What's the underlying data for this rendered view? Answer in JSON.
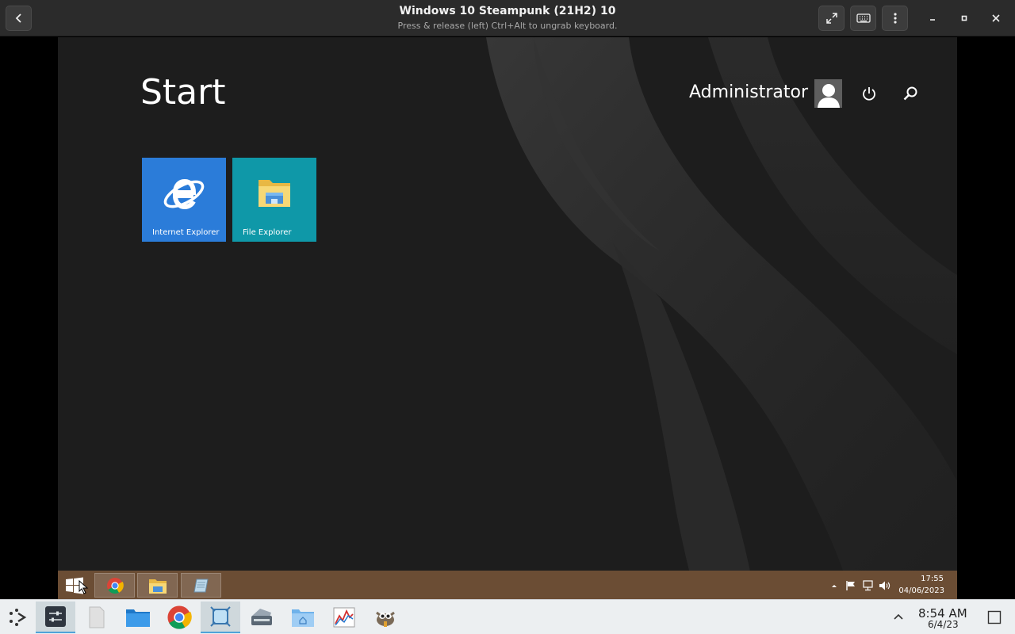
{
  "header": {
    "title": "Windows 10 Steampunk (21H2) 10",
    "subtitle": "Press & release (left) Ctrl+Alt to ungrab keyboard."
  },
  "start": {
    "title": "Start",
    "user_name": "Administrator",
    "tiles": [
      {
        "label": "Internet Explorer",
        "color": "#2b7cd9"
      },
      {
        "label": "File Explorer",
        "color": "#0f98a8"
      }
    ]
  },
  "guest_taskbar": {
    "time": "17:55",
    "date": "04/06/2023",
    "color": "#6b4d34"
  },
  "host_taskbar": {
    "time": "8:54 AM",
    "date": "6/4/23"
  }
}
